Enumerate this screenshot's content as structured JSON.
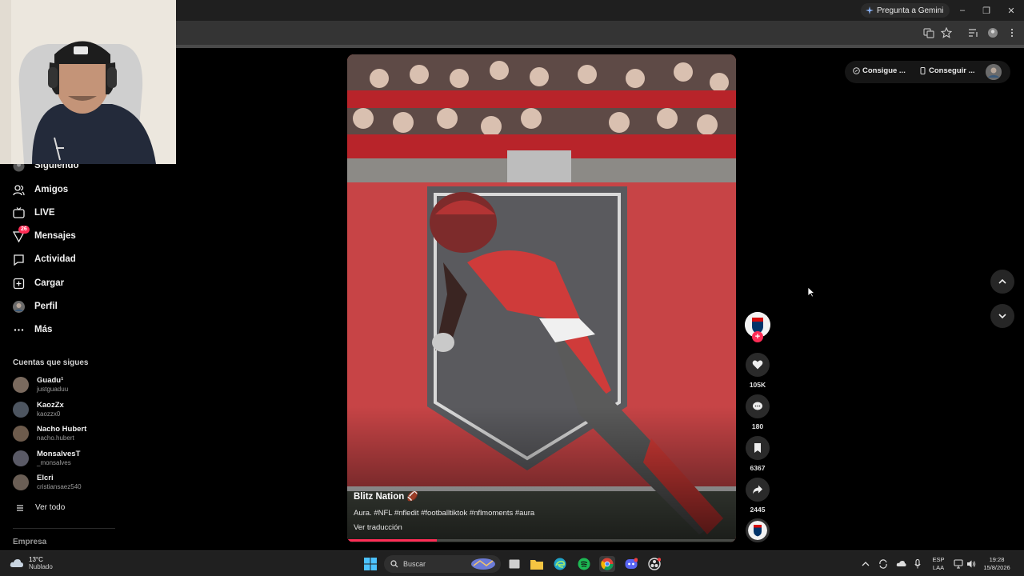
{
  "browser": {
    "gemini_label": "Pregunta a Gemini"
  },
  "sidebar": {
    "items": [
      {
        "label": "Siguiendo",
        "icon": "following-avatar-icon"
      },
      {
        "label": "Amigos",
        "icon": "friends-icon"
      },
      {
        "label": "LIVE",
        "icon": "live-icon"
      },
      {
        "label": "Mensajes",
        "icon": "messages-icon",
        "badge": "26"
      },
      {
        "label": "Actividad",
        "icon": "activity-icon"
      },
      {
        "label": "Cargar",
        "icon": "upload-icon"
      },
      {
        "label": "Perfil",
        "icon": "profile-avatar-icon"
      },
      {
        "label": "Más",
        "icon": "more-icon"
      }
    ],
    "following_title": "Cuentas que sigues",
    "following": [
      {
        "name": "Guadu¹",
        "handle": "justguaduu"
      },
      {
        "name": "KaozZx",
        "handle": "kaozzx0"
      },
      {
        "name": "Nacho Hubert",
        "handle": "nacho.hubert"
      },
      {
        "name": "MonsalvesT",
        "handle": "_monsalves"
      },
      {
        "name": "Elcri",
        "handle": "cristiansaez540"
      }
    ],
    "see_all": "Ver todo",
    "company": "Empresa"
  },
  "video": {
    "author": "Blitz Nation 🏈",
    "caption": "Aura. #NFL #nfledit #footballtiktok #nflmoments #aura",
    "translate": "Ver traducción",
    "progress_fraction": 0.23
  },
  "actions": {
    "likes": "105K",
    "comments": "180",
    "saves": "6367",
    "shares": "2445"
  },
  "top_right": {
    "coins_label": "Consigue ...",
    "app_label": "Conseguir ..."
  },
  "taskbar": {
    "temp": "13°C",
    "weather": "Nublado",
    "search_placeholder": "Buscar",
    "lang_top": "ESP",
    "lang_bottom": "LAA",
    "time": "19:28",
    "date": "15/8/2026"
  },
  "colors": {
    "accent": "#fe2c55",
    "background": "#000000"
  }
}
